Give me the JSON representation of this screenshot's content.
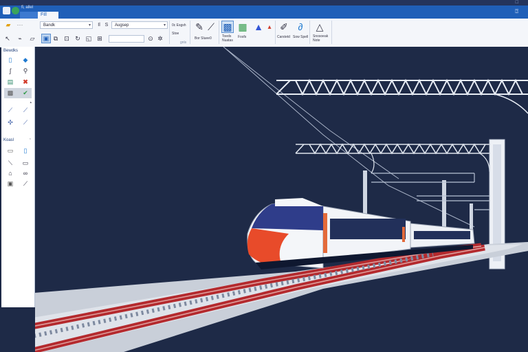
{
  "window": {
    "title_right": "□"
  },
  "tabbar": {
    "tabs": [
      {
        "label": "",
        "active": false
      },
      {
        "label": "Fill",
        "active": true
      }
    ],
    "quick_access_text": "fi, allel"
  },
  "ribbon": {
    "font_combo": "Bandk",
    "style_combo": "Augsep",
    "find_label": "0c Esgsh",
    "style_label": "Stoe",
    "bring_label": "Bor Sluee0",
    "group_label": "gnls",
    "items": [
      {
        "label": "Toeds\nNuatas"
      },
      {
        "label": "Fosfs"
      },
      {
        "label": "Carstetd"
      },
      {
        "label": "Sow Spell"
      },
      {
        "label": "Snosoeak\nNote"
      }
    ]
  },
  "panel": {
    "section1_title": "Bewdks",
    "section2_title": "Koasl"
  },
  "colors": {
    "canvas_bg": "#1e2a47",
    "tab_bar": "#1f5fb8",
    "train_nose": "#e84b2a",
    "rail_red": "#b42a2e"
  }
}
